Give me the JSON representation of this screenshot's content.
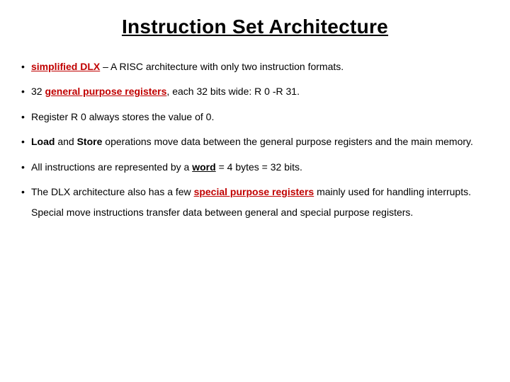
{
  "title": "Instruction Set Architecture",
  "bullets": {
    "b0": {
      "p0": "simplified DLX",
      "p1": " – A RISC architecture with only two instruction formats."
    },
    "b1": {
      "p0": "32 ",
      "p1": "general purpose registers",
      "p2": ", each 32 bits wide: R 0 -R 31."
    },
    "b2": {
      "p0": "Register R 0 always stores the value of 0."
    },
    "b3": {
      "p0": "Load",
      "p1": " and ",
      "p2": "Store",
      "p3": " operations move data between the general purpose registers and the main memory."
    },
    "b4": {
      "p0": "All instructions are represented by a ",
      "p1": "word",
      "p2": " = 4 bytes = 32 bits."
    },
    "b5": {
      "p0": "The DLX architecture also has a few ",
      "p1": "special purpose registers",
      "p2": " mainly used for handling interrupts. Special move instructions transfer data between general and special purpose registers."
    }
  }
}
